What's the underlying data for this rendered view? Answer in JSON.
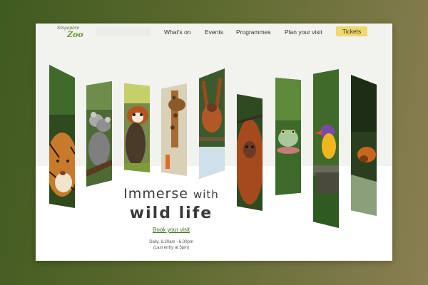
{
  "logo": {
    "top_text": "Singapore",
    "bottom_text": "Zoo"
  },
  "nav": {
    "items": [
      "What's on",
      "Events",
      "Programmes",
      "Plan your visit"
    ],
    "cta": "Tickets"
  },
  "hero": {
    "headline_part1": "Immerse",
    "headline_part2": "with",
    "headline_line2": "wild life",
    "book_link": "Book your visit",
    "hours_line1": "Daily, 8.30am - 6.00pm",
    "hours_line2": "(Last entry at 5pm)"
  },
  "colors": {
    "background_start": "#3f5a1f",
    "background_end": "#8a7f52",
    "cta": "#efd96a",
    "link": "#3d6a1e"
  },
  "gallery": {
    "animals": [
      "tiger",
      "koala",
      "red-panda",
      "giraffe",
      "orangutan-hanging",
      "orangutan",
      "frog",
      "kingfisher",
      "tamarin"
    ]
  }
}
